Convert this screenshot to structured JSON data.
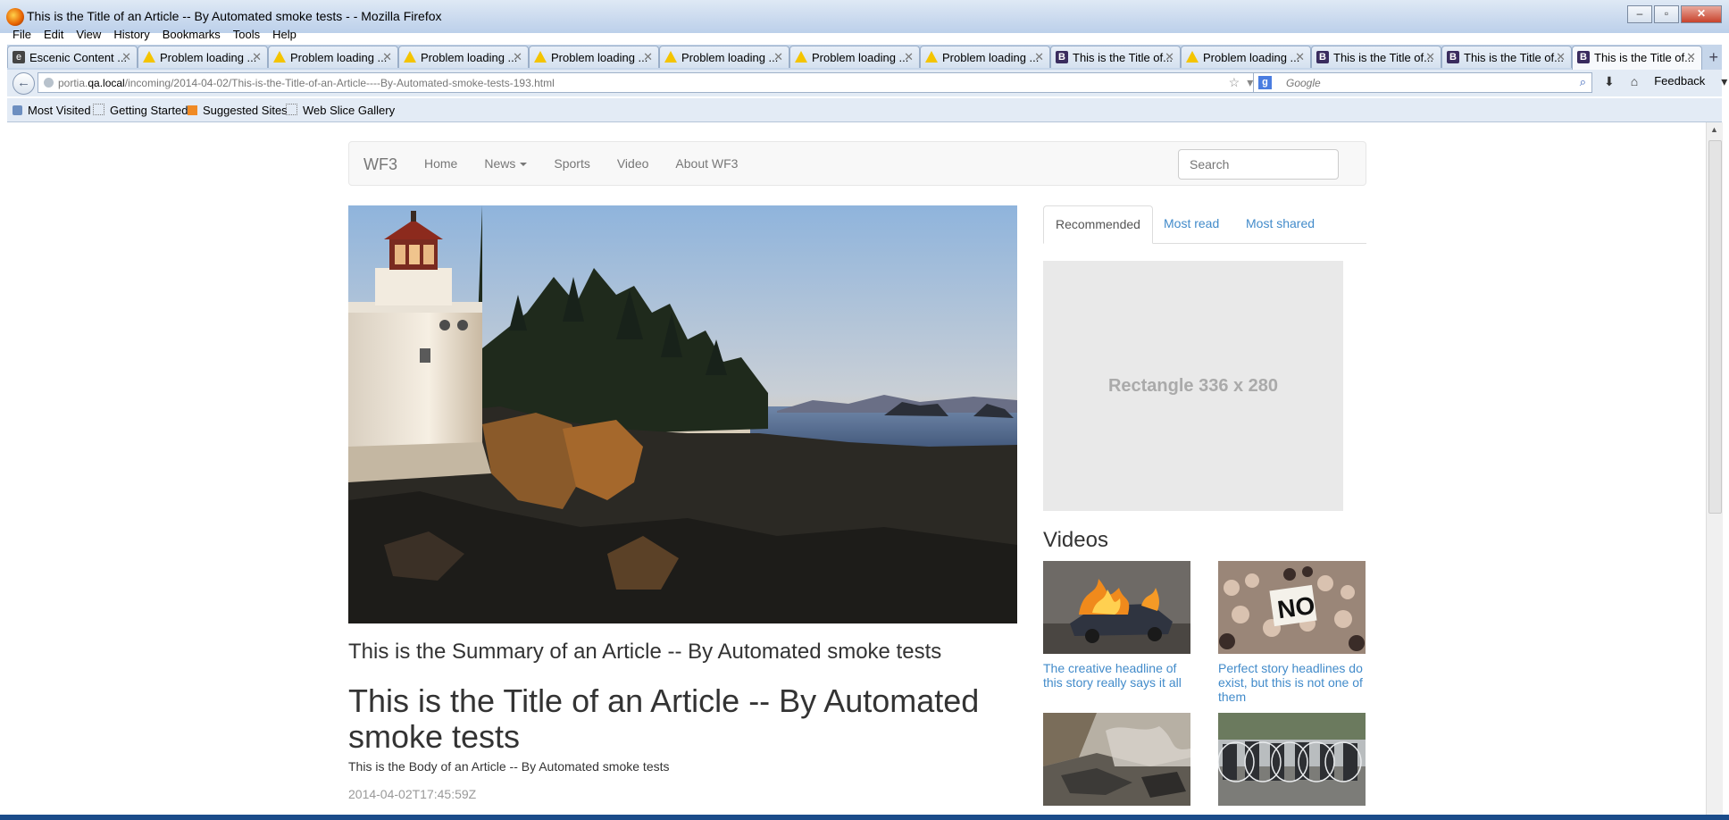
{
  "window": {
    "title": "This is the Title of an Article -- By Automated smoke tests - - Mozilla Firefox",
    "minimize": "–",
    "maximize": "▫",
    "close": "✕"
  },
  "menu": [
    "File",
    "Edit",
    "View",
    "History",
    "Bookmarks",
    "Tools",
    "Help"
  ],
  "tabs": [
    {
      "label": "Escenic Content ...",
      "icon": "escenic-icon"
    },
    {
      "label": "Problem loading ...",
      "icon": "warning-icon"
    },
    {
      "label": "Problem loading ...",
      "icon": "warning-icon"
    },
    {
      "label": "Problem loading ...",
      "icon": "warning-icon"
    },
    {
      "label": "Problem loading ...",
      "icon": "warning-icon"
    },
    {
      "label": "Problem loading ...",
      "icon": "warning-icon"
    },
    {
      "label": "Problem loading ...",
      "icon": "warning-icon"
    },
    {
      "label": "Problem loading ...",
      "icon": "warning-icon"
    },
    {
      "label": "This is the Title of...",
      "icon": "bootstrap-icon"
    },
    {
      "label": "Problem loading ...",
      "icon": "warning-icon"
    },
    {
      "label": "This is the Title of...",
      "icon": "bootstrap-icon"
    },
    {
      "label": "This is the Title of...",
      "icon": "bootstrap-icon"
    },
    {
      "label": "This is the Title of...",
      "icon": "bootstrap-icon",
      "active": true
    }
  ],
  "tab_close": "✕",
  "new_tab": "+",
  "address": {
    "prefix": "portia.",
    "host": "qa.local",
    "path": "/incoming/2014-04-02/This-is-the-Title-of-an-Article----By-Automated-smoke-tests-193.html"
  },
  "search_engine": {
    "placeholder": "Google",
    "badge": "g"
  },
  "feedback_label": "Feedback",
  "bookmarks": [
    "Most Visited",
    "Getting Started",
    "Suggested Sites",
    "Web Slice Gallery"
  ],
  "site": {
    "brand": "WF3",
    "nav": [
      "Home",
      "News",
      "Sports",
      "Video",
      "About WF3"
    ],
    "search_placeholder": "Search"
  },
  "article": {
    "summary": "This is the Summary of an Article -- By Automated smoke tests",
    "title": "This is the Title of an Article -- By Automated smoke tests",
    "body": "This is the Body of an Article -- By Automated smoke tests",
    "date": "2014-04-02T17:45:59Z"
  },
  "sidebar": {
    "tabs": [
      "Recommended",
      "Most read",
      "Most shared"
    ],
    "ad_label": "Rectangle 336 x 280",
    "videos_heading": "Videos",
    "videos": [
      {
        "caption": "The creative headline of this story really says it all"
      },
      {
        "caption": "Perfect story headlines do exist, but this is not one of them"
      },
      {
        "caption": ""
      },
      {
        "caption": ""
      }
    ]
  },
  "colors": {
    "link": "#428bca",
    "navbar_bg": "#f8f8f8",
    "titlebar": "#c9d9ee"
  }
}
